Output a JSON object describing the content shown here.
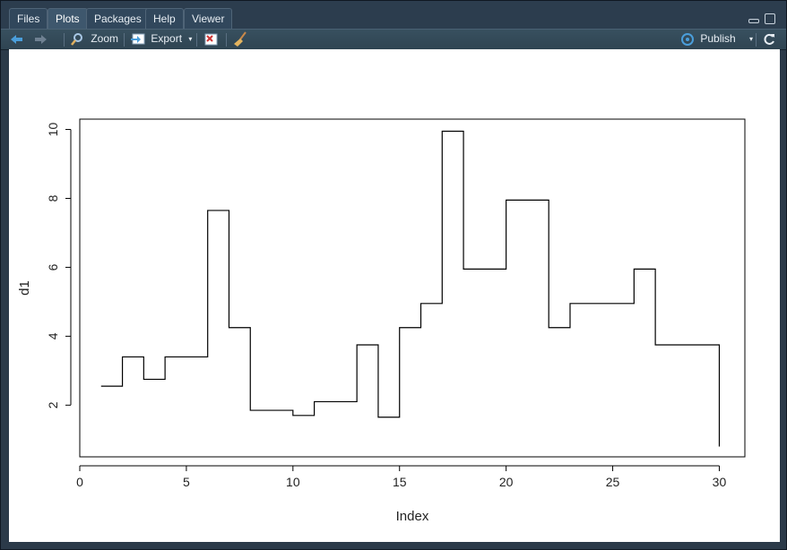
{
  "tabs": [
    {
      "label": "Files",
      "active": false
    },
    {
      "label": "Plots",
      "active": true
    },
    {
      "label": "Packages",
      "active": false
    },
    {
      "label": "Help",
      "active": false
    },
    {
      "label": "Viewer",
      "active": false
    }
  ],
  "toolbar": {
    "zoom_label": "Zoom",
    "export_label": "Export",
    "publish_label": "Publish",
    "icons": [
      "back-arrow-icon",
      "forward-arrow-icon",
      "zoom-icon",
      "export-icon",
      "remove-plot-icon",
      "broom-icon",
      "publish-icon",
      "refresh-icon"
    ]
  },
  "colors": {
    "tab_bar": "#2c3d4e",
    "toolbar": "#38505f",
    "plot_background": "#ffffff",
    "line": "#000000",
    "back_arrow": "#4a9edb",
    "publish_icon": "#4a9edb"
  },
  "chart_data": {
    "type": "line",
    "plot_style": "step",
    "title": "",
    "xlabel": "Index",
    "ylabel": "d1",
    "xlim": [
      0,
      31.2
    ],
    "ylim": [
      0.5,
      10.3
    ],
    "x_ticks": [
      0,
      5,
      10,
      15,
      20,
      25,
      30
    ],
    "y_ticks": [
      2,
      4,
      6,
      8,
      10
    ],
    "grid": false,
    "legend": false,
    "series": [
      {
        "x": [
          1,
          2,
          3,
          4,
          5,
          6,
          7,
          8,
          9,
          10,
          11,
          12,
          13,
          14,
          15,
          16,
          17,
          18,
          19,
          20,
          21,
          22,
          23,
          24,
          25,
          26,
          27,
          28,
          29,
          30
        ],
        "values": [
          2.55,
          3.4,
          2.75,
          3.4,
          3.4,
          7.65,
          4.25,
          1.85,
          1.85,
          1.7,
          2.1,
          2.1,
          3.75,
          1.65,
          4.25,
          4.95,
          9.95,
          5.95,
          5.95,
          7.95,
          7.95,
          4.25,
          4.95,
          4.95,
          4.95,
          5.95,
          3.75,
          3.75,
          3.75,
          0.8
        ]
      }
    ]
  }
}
